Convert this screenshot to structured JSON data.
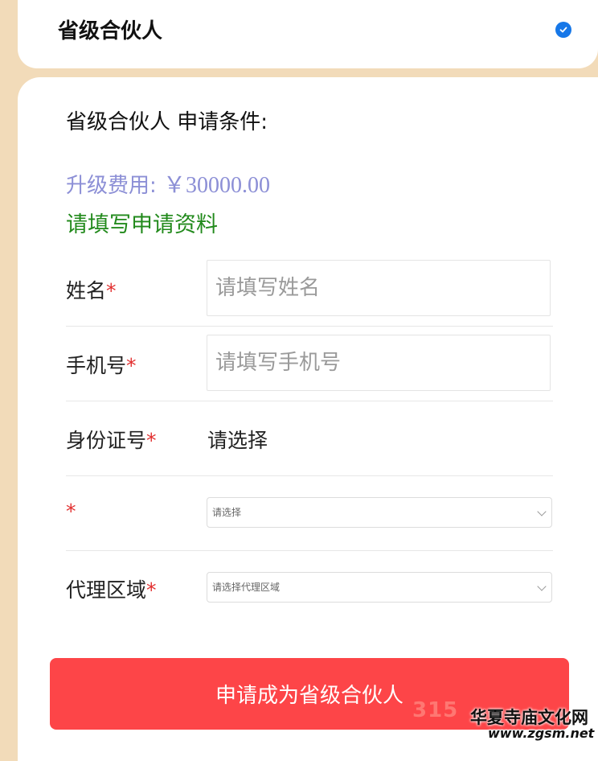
{
  "header": {
    "title": "省级合伙人",
    "selected_icon": "check-circle-icon",
    "accent": "#1677e8"
  },
  "conditions": {
    "title": "省级合伙人  申请条件:"
  },
  "fee": {
    "label": "升级费用:",
    "amount": "￥30000.00"
  },
  "form": {
    "heading": "请填写申请资料",
    "required_mark": "*",
    "fields": [
      {
        "label": "姓名",
        "placeholder": "请填写姓名"
      },
      {
        "label": "手机号",
        "placeholder": "请填写手机号"
      },
      {
        "label": "身份证号",
        "value": "请选择"
      },
      {
        "label": "",
        "select_value": "请选择"
      },
      {
        "label": "代理区域",
        "select_value": "请选择代理区域"
      }
    ]
  },
  "submit": {
    "label": "申请成为省级合伙人",
    "color": "#fd4548"
  },
  "watermark": {
    "brand": "315",
    "site_name": "华夏寺庙文化网",
    "url": "www.zgsm.net"
  }
}
